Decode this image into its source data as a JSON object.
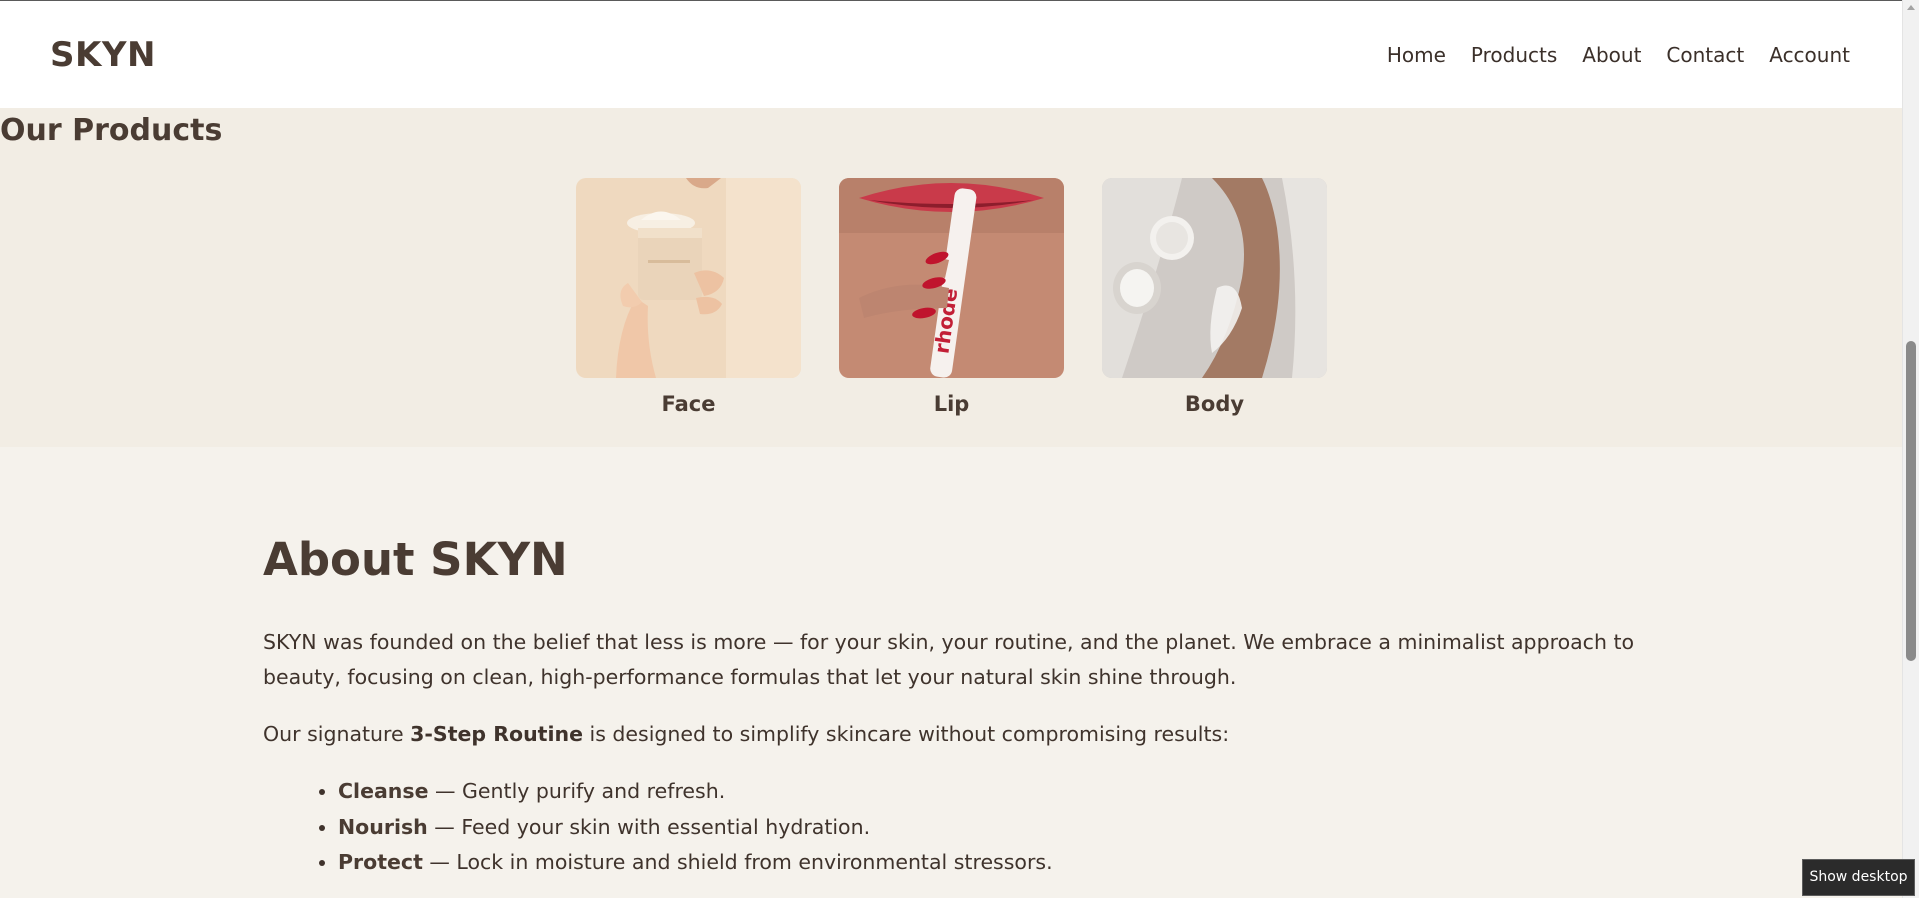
{
  "brand": {
    "logo": "SKYN"
  },
  "nav": {
    "items": [
      {
        "label": "Home"
      },
      {
        "label": "Products"
      },
      {
        "label": "About"
      },
      {
        "label": "Contact"
      },
      {
        "label": "Account"
      }
    ]
  },
  "products": {
    "title": "Our Products",
    "cards": [
      {
        "label": "Face",
        "image": "cream-jar-photo"
      },
      {
        "label": "Lip",
        "image": "lip-tube-photo"
      },
      {
        "label": "Body",
        "image": "body-cream-photo"
      }
    ]
  },
  "about": {
    "title": "About SKYN",
    "paragraph1": "SKYN was founded on the belief that less is more — for your skin, your routine, and the planet. We embrace a minimalist approach to beauty, focusing on clean, high-performance formulas that let your natural skin shine through.",
    "paragraph2_prefix": "Our signature ",
    "paragraph2_bold": "3-Step Routine",
    "paragraph2_suffix": " is designed to simplify skincare without compromising results:",
    "steps": [
      {
        "name": "Cleanse",
        "text": " — Gently purify and refresh."
      },
      {
        "name": "Nourish",
        "text": " — Feed your skin with essential hydration."
      },
      {
        "name": "Protect",
        "text": " — Lock in moisture and shield from environmental stressors."
      }
    ]
  },
  "tooltip": {
    "text": "Show desktop"
  },
  "colors": {
    "text": "#4a3c33",
    "header_bg": "#ffffff",
    "products_bg": "#f2ede4",
    "about_bg": "#f5f2ec"
  }
}
